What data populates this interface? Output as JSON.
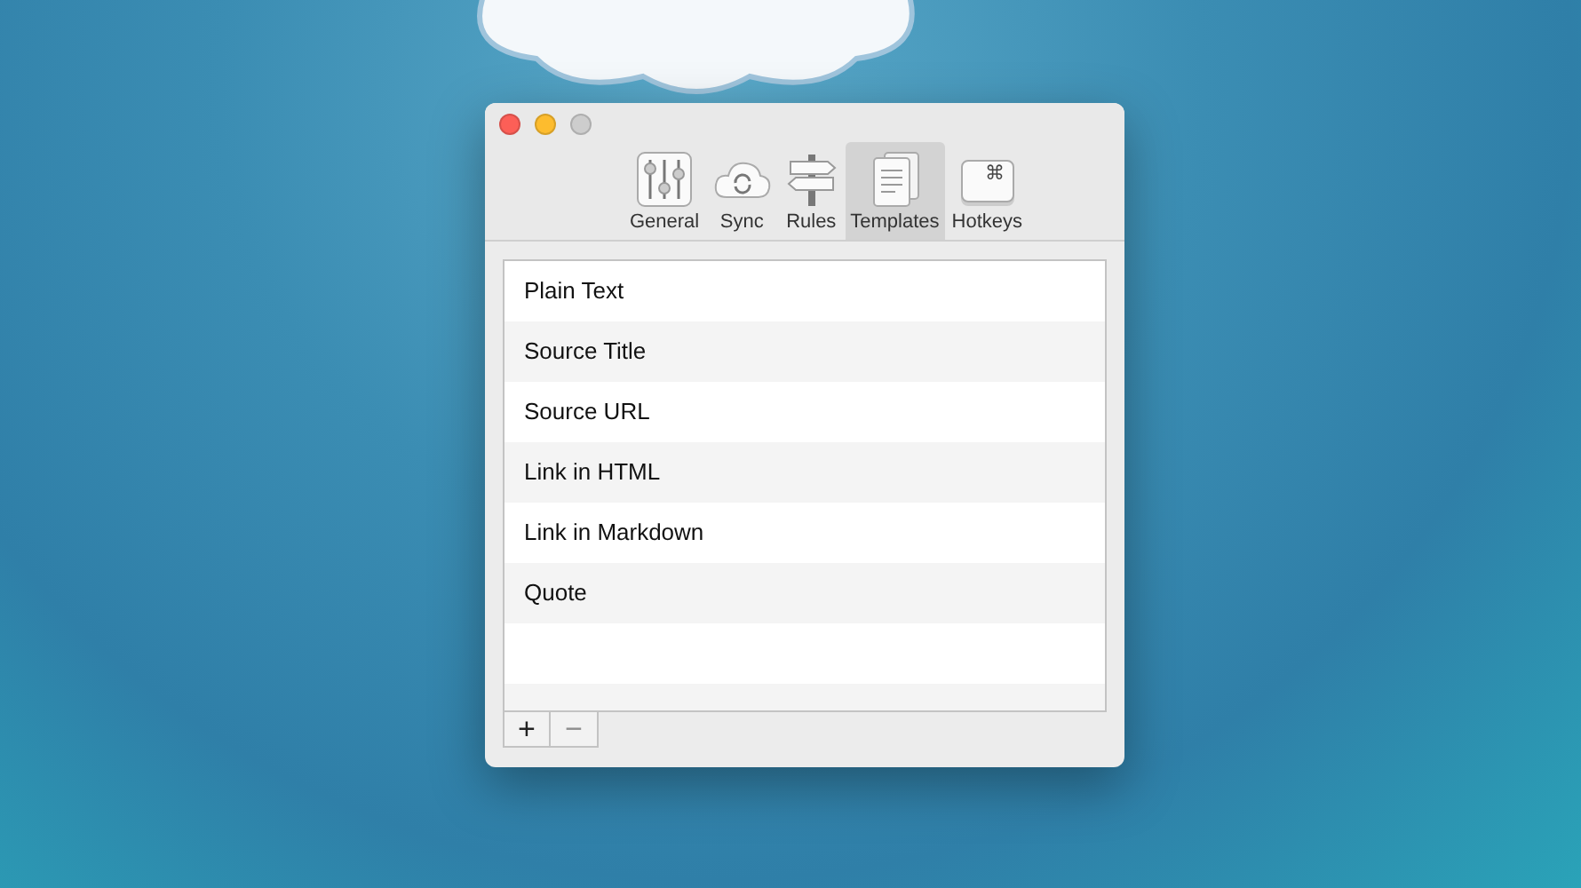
{
  "window": {
    "traffic_lights": [
      {
        "kind": "close",
        "disabled": false
      },
      {
        "kind": "minimize",
        "disabled": false
      },
      {
        "kind": "zoom",
        "disabled": true
      }
    ]
  },
  "tabs": [
    {
      "label": "General",
      "kind": "sliders",
      "selected": false
    },
    {
      "label": "Sync",
      "kind": "cloud",
      "selected": false
    },
    {
      "label": "Rules",
      "kind": "signpost",
      "selected": false
    },
    {
      "label": "Templates",
      "kind": "pages",
      "selected": true
    },
    {
      "label": "Hotkeys",
      "kind": "key",
      "symbol": "⌘",
      "selected": false
    }
  ],
  "templates": {
    "rows": [
      "Plain Text",
      "Source Title",
      "Source URL",
      "Link in HTML",
      "Link in Markdown",
      "Quote"
    ]
  },
  "buttons": [
    {
      "label": "+",
      "disabled": false
    },
    {
      "label": "−",
      "disabled": true
    }
  ]
}
